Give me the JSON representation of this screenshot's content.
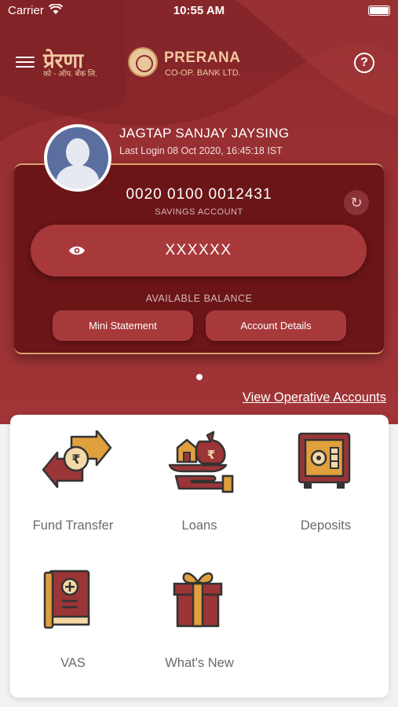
{
  "status_bar": {
    "carrier": "Carrier",
    "time": "10:55 AM"
  },
  "header": {
    "logo_hindi": "प्रेरणा",
    "logo_hindi_sub": "को - ऑप. बँक लि.",
    "logo_brand": "PRERANA",
    "logo_brand_sub": "CO-OP. BANK LTD."
  },
  "user": {
    "name": "JAGTAP SANJAY JAYSING",
    "last_login": "Last Login 08 Oct 2020, 16:45:18 IST"
  },
  "account": {
    "number": "0020 0100 0012431",
    "type": "SAVINGS ACCOUNT",
    "balance_masked": "XXXXXX",
    "available_balance_label": "AVAILABLE BALANCE",
    "mini_statement_label": "Mini Statement",
    "account_details_label": "Account Details"
  },
  "view_operative_accounts": "View Operative Accounts",
  "services": [
    {
      "label": "Fund Transfer",
      "icon": "fund-transfer-icon"
    },
    {
      "label": "Loans",
      "icon": "loans-icon"
    },
    {
      "label": "Deposits",
      "icon": "deposits-safe-icon"
    },
    {
      "label": "VAS",
      "icon": "vas-book-icon"
    },
    {
      "label": "What's New",
      "icon": "gift-icon"
    }
  ],
  "colors": {
    "brand_maroon": "#9a3033",
    "card_dark": "#6b1517",
    "gold": "#d9a06b",
    "pill": "#a8393b"
  }
}
